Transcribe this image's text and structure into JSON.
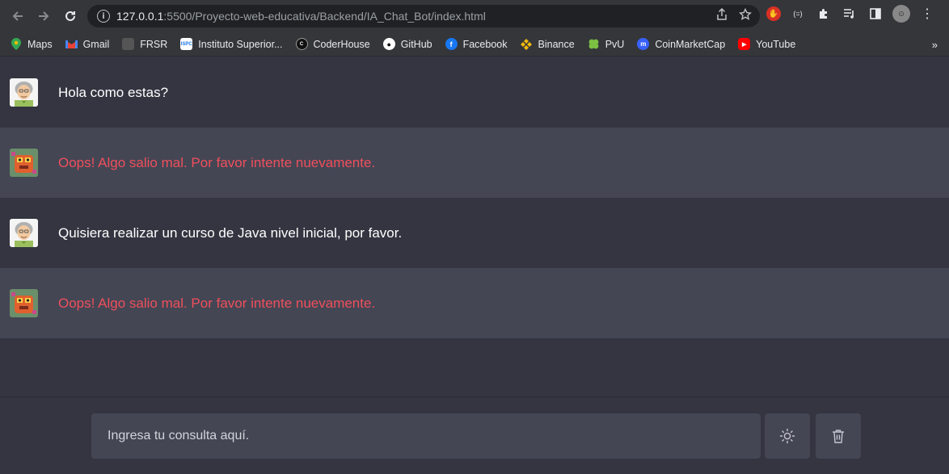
{
  "browser": {
    "url_host": "127.0.0.1",
    "url_path": ":5500/Proyecto-web-educativa/Backend/IA_Chat_Bot/index.html",
    "ext_badge": "(=)"
  },
  "bookmarks": [
    {
      "label": "Maps",
      "color": "#34a853",
      "icon": "maps-icon"
    },
    {
      "label": "Gmail",
      "color": "#ea4335",
      "icon": "gmail-icon"
    },
    {
      "label": "FRSR",
      "color": "#555555",
      "icon": "frsr-icon"
    },
    {
      "label": "Instituto Superior...",
      "color": "#1a73e8",
      "icon": "isp-icon"
    },
    {
      "label": "CoderHouse",
      "color": "#111111",
      "icon": "coderhouse-icon"
    },
    {
      "label": "GitHub",
      "color": "#ffffff",
      "icon": "github-icon"
    },
    {
      "label": "Facebook",
      "color": "#1877f2",
      "icon": "facebook-icon"
    },
    {
      "label": "Binance",
      "color": "#f0b90b",
      "icon": "binance-icon"
    },
    {
      "label": "PvU",
      "color": "#7cc142",
      "icon": "clover-icon"
    },
    {
      "label": "CoinMarketCap",
      "color": "#3861fb",
      "icon": "coinmarketcap-icon"
    },
    {
      "label": "YouTube",
      "color": "#ff0000",
      "icon": "youtube-icon"
    }
  ],
  "chat": {
    "messages": [
      {
        "role": "user",
        "text": "Hola como estas?"
      },
      {
        "role": "bot",
        "text": "Oops! Algo salio mal. Por favor intente nuevamente."
      },
      {
        "role": "user",
        "text": "Quisiera realizar un curso de Java nivel inicial, por favor."
      },
      {
        "role": "bot",
        "text": "Oops! Algo salio mal. Por favor intente nuevamente."
      }
    ]
  },
  "composer": {
    "placeholder": "Ingresa tu consulta aquí."
  },
  "colors": {
    "background": "#343541",
    "bot_row": "#444654",
    "error_text": "#ef4f5c"
  }
}
